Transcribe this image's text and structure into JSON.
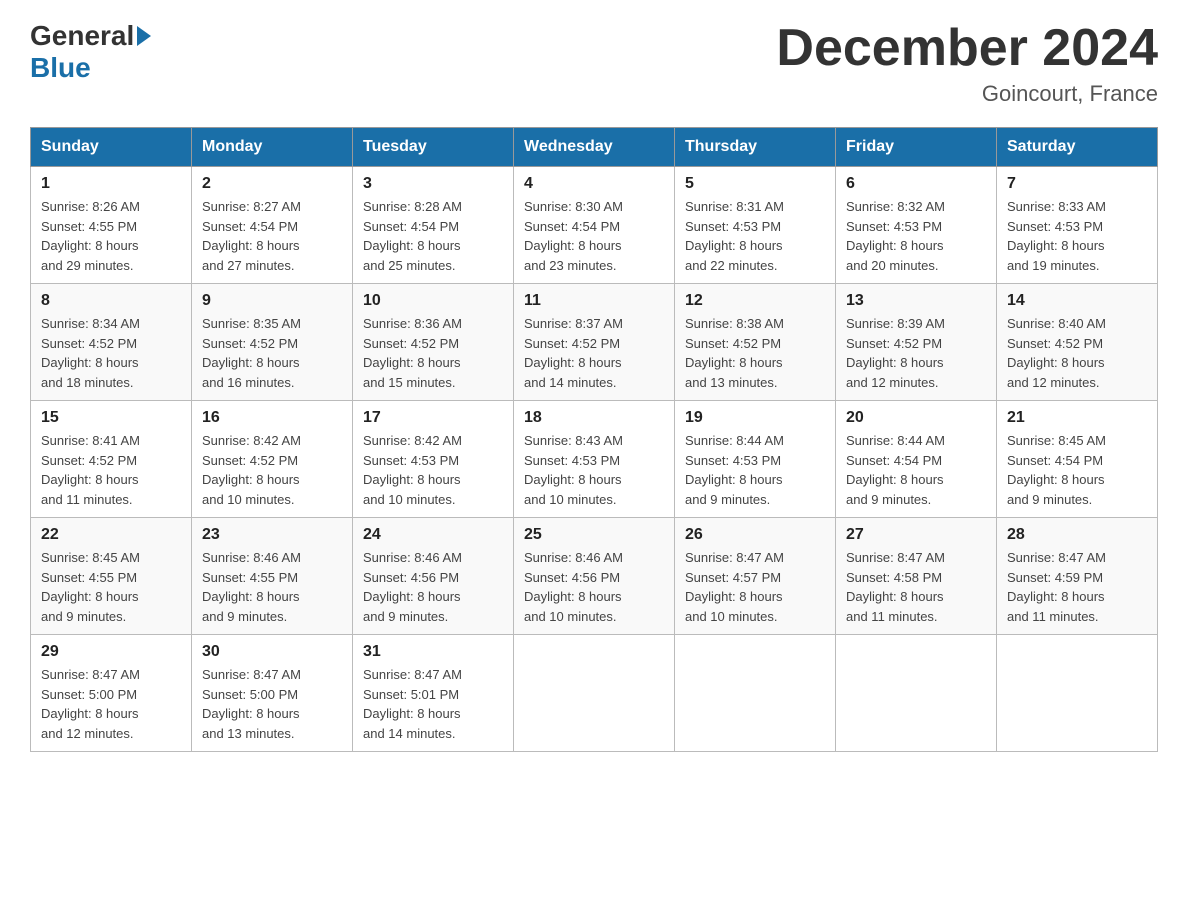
{
  "header": {
    "logo_general": "General",
    "logo_blue": "Blue",
    "month_title": "December 2024",
    "location": "Goincourt, France"
  },
  "weekdays": [
    "Sunday",
    "Monday",
    "Tuesday",
    "Wednesday",
    "Thursday",
    "Friday",
    "Saturday"
  ],
  "weeks": [
    [
      {
        "day": "1",
        "sunrise": "8:26 AM",
        "sunset": "4:55 PM",
        "daylight": "8 hours and 29 minutes."
      },
      {
        "day": "2",
        "sunrise": "8:27 AM",
        "sunset": "4:54 PM",
        "daylight": "8 hours and 27 minutes."
      },
      {
        "day": "3",
        "sunrise": "8:28 AM",
        "sunset": "4:54 PM",
        "daylight": "8 hours and 25 minutes."
      },
      {
        "day": "4",
        "sunrise": "8:30 AM",
        "sunset": "4:54 PM",
        "daylight": "8 hours and 23 minutes."
      },
      {
        "day": "5",
        "sunrise": "8:31 AM",
        "sunset": "4:53 PM",
        "daylight": "8 hours and 22 minutes."
      },
      {
        "day": "6",
        "sunrise": "8:32 AM",
        "sunset": "4:53 PM",
        "daylight": "8 hours and 20 minutes."
      },
      {
        "day": "7",
        "sunrise": "8:33 AM",
        "sunset": "4:53 PM",
        "daylight": "8 hours and 19 minutes."
      }
    ],
    [
      {
        "day": "8",
        "sunrise": "8:34 AM",
        "sunset": "4:52 PM",
        "daylight": "8 hours and 18 minutes."
      },
      {
        "day": "9",
        "sunrise": "8:35 AM",
        "sunset": "4:52 PM",
        "daylight": "8 hours and 16 minutes."
      },
      {
        "day": "10",
        "sunrise": "8:36 AM",
        "sunset": "4:52 PM",
        "daylight": "8 hours and 15 minutes."
      },
      {
        "day": "11",
        "sunrise": "8:37 AM",
        "sunset": "4:52 PM",
        "daylight": "8 hours and 14 minutes."
      },
      {
        "day": "12",
        "sunrise": "8:38 AM",
        "sunset": "4:52 PM",
        "daylight": "8 hours and 13 minutes."
      },
      {
        "day": "13",
        "sunrise": "8:39 AM",
        "sunset": "4:52 PM",
        "daylight": "8 hours and 12 minutes."
      },
      {
        "day": "14",
        "sunrise": "8:40 AM",
        "sunset": "4:52 PM",
        "daylight": "8 hours and 12 minutes."
      }
    ],
    [
      {
        "day": "15",
        "sunrise": "8:41 AM",
        "sunset": "4:52 PM",
        "daylight": "8 hours and 11 minutes."
      },
      {
        "day": "16",
        "sunrise": "8:42 AM",
        "sunset": "4:52 PM",
        "daylight": "8 hours and 10 minutes."
      },
      {
        "day": "17",
        "sunrise": "8:42 AM",
        "sunset": "4:53 PM",
        "daylight": "8 hours and 10 minutes."
      },
      {
        "day": "18",
        "sunrise": "8:43 AM",
        "sunset": "4:53 PM",
        "daylight": "8 hours and 10 minutes."
      },
      {
        "day": "19",
        "sunrise": "8:44 AM",
        "sunset": "4:53 PM",
        "daylight": "8 hours and 9 minutes."
      },
      {
        "day": "20",
        "sunrise": "8:44 AM",
        "sunset": "4:54 PM",
        "daylight": "8 hours and 9 minutes."
      },
      {
        "day": "21",
        "sunrise": "8:45 AM",
        "sunset": "4:54 PM",
        "daylight": "8 hours and 9 minutes."
      }
    ],
    [
      {
        "day": "22",
        "sunrise": "8:45 AM",
        "sunset": "4:55 PM",
        "daylight": "8 hours and 9 minutes."
      },
      {
        "day": "23",
        "sunrise": "8:46 AM",
        "sunset": "4:55 PM",
        "daylight": "8 hours and 9 minutes."
      },
      {
        "day": "24",
        "sunrise": "8:46 AM",
        "sunset": "4:56 PM",
        "daylight": "8 hours and 9 minutes."
      },
      {
        "day": "25",
        "sunrise": "8:46 AM",
        "sunset": "4:56 PM",
        "daylight": "8 hours and 10 minutes."
      },
      {
        "day": "26",
        "sunrise": "8:47 AM",
        "sunset": "4:57 PM",
        "daylight": "8 hours and 10 minutes."
      },
      {
        "day": "27",
        "sunrise": "8:47 AM",
        "sunset": "4:58 PM",
        "daylight": "8 hours and 11 minutes."
      },
      {
        "day": "28",
        "sunrise": "8:47 AM",
        "sunset": "4:59 PM",
        "daylight": "8 hours and 11 minutes."
      }
    ],
    [
      {
        "day": "29",
        "sunrise": "8:47 AM",
        "sunset": "5:00 PM",
        "daylight": "8 hours and 12 minutes."
      },
      {
        "day": "30",
        "sunrise": "8:47 AM",
        "sunset": "5:00 PM",
        "daylight": "8 hours and 13 minutes."
      },
      {
        "day": "31",
        "sunrise": "8:47 AM",
        "sunset": "5:01 PM",
        "daylight": "8 hours and 14 minutes."
      },
      null,
      null,
      null,
      null
    ]
  ],
  "labels": {
    "sunrise": "Sunrise:",
    "sunset": "Sunset:",
    "daylight": "Daylight:"
  }
}
